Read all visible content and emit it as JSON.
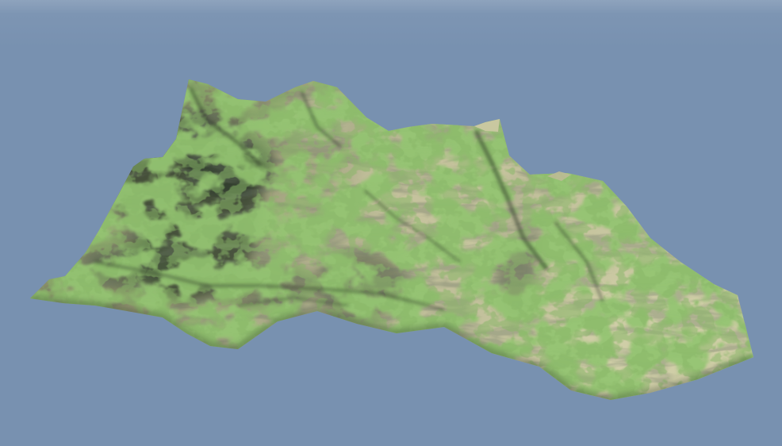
{
  "scene": {
    "colors": {
      "sky": "#7891b0",
      "rock_light": "#c9c7a0",
      "rock_mid": "#a7a682",
      "rock_dark": "#3b4636",
      "moss": "#4f8a2c",
      "moss_dark": "#3f6b24"
    },
    "objects": [
      "sky-background",
      "terrain-mesh"
    ]
  }
}
